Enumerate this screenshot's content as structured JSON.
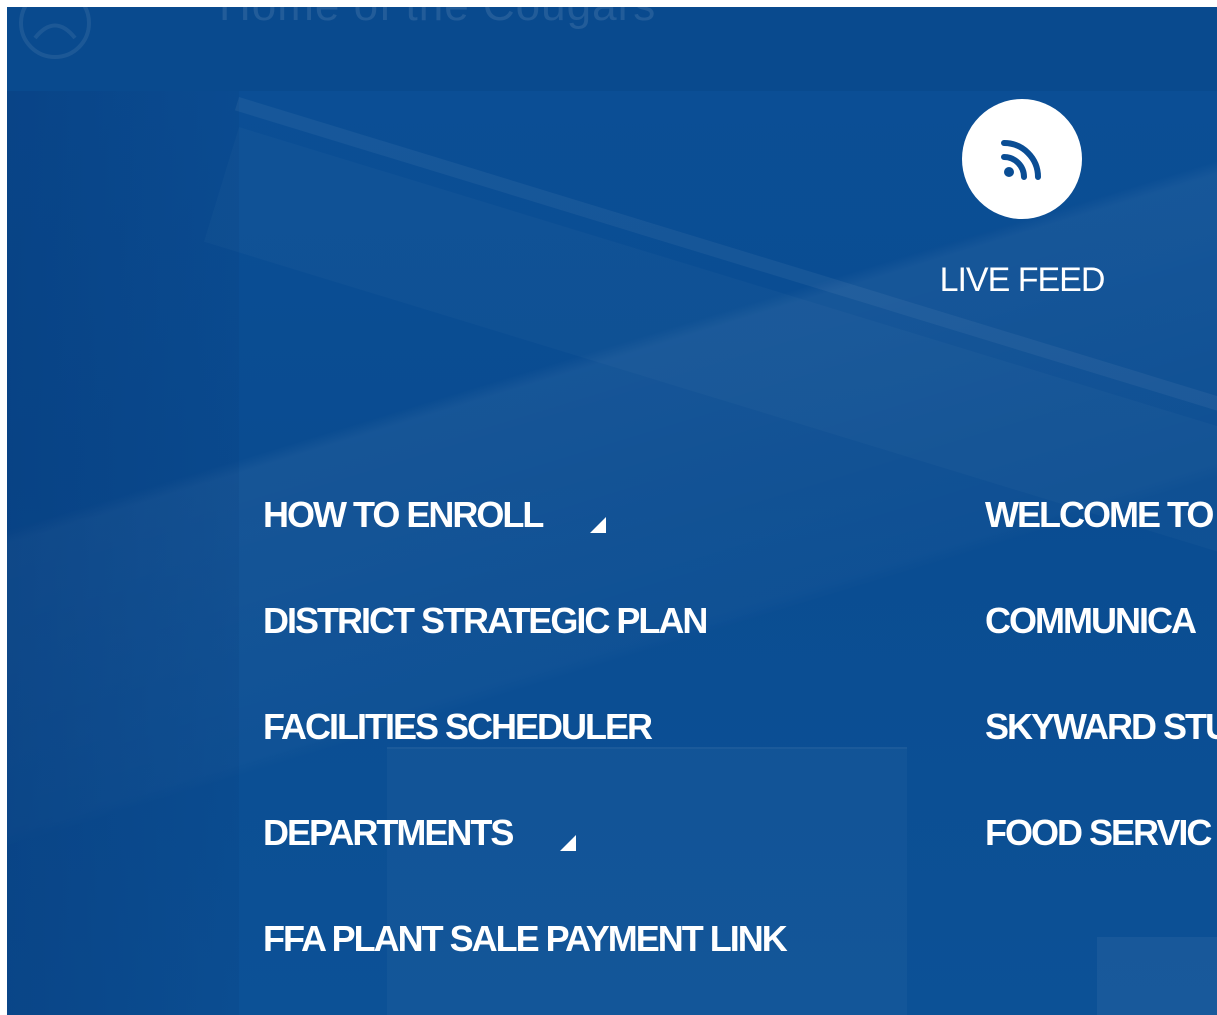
{
  "site": {
    "title": "Home of the Cougars"
  },
  "live_feed": {
    "icon": "rss-icon",
    "label": "LIVE FEED"
  },
  "menu": {
    "left": [
      {
        "label": "HOW TO ENROLL",
        "has_submenu": true
      },
      {
        "label": "DISTRICT STRATEGIC PLAN",
        "has_submenu": false
      },
      {
        "label": "FACILITIES SCHEDULER",
        "has_submenu": false
      },
      {
        "label": "DEPARTMENTS",
        "has_submenu": true
      },
      {
        "label": "FFA PLANT SALE PAYMENT LINK",
        "has_submenu": false
      }
    ],
    "right": [
      {
        "label": "WELCOME TO"
      },
      {
        "label": "COMMUNICA"
      },
      {
        "label": "SKYWARD STU"
      },
      {
        "label": "FOOD SERVIC"
      }
    ]
  },
  "colors": {
    "background": "#0a4d94",
    "text": "#ffffff"
  }
}
